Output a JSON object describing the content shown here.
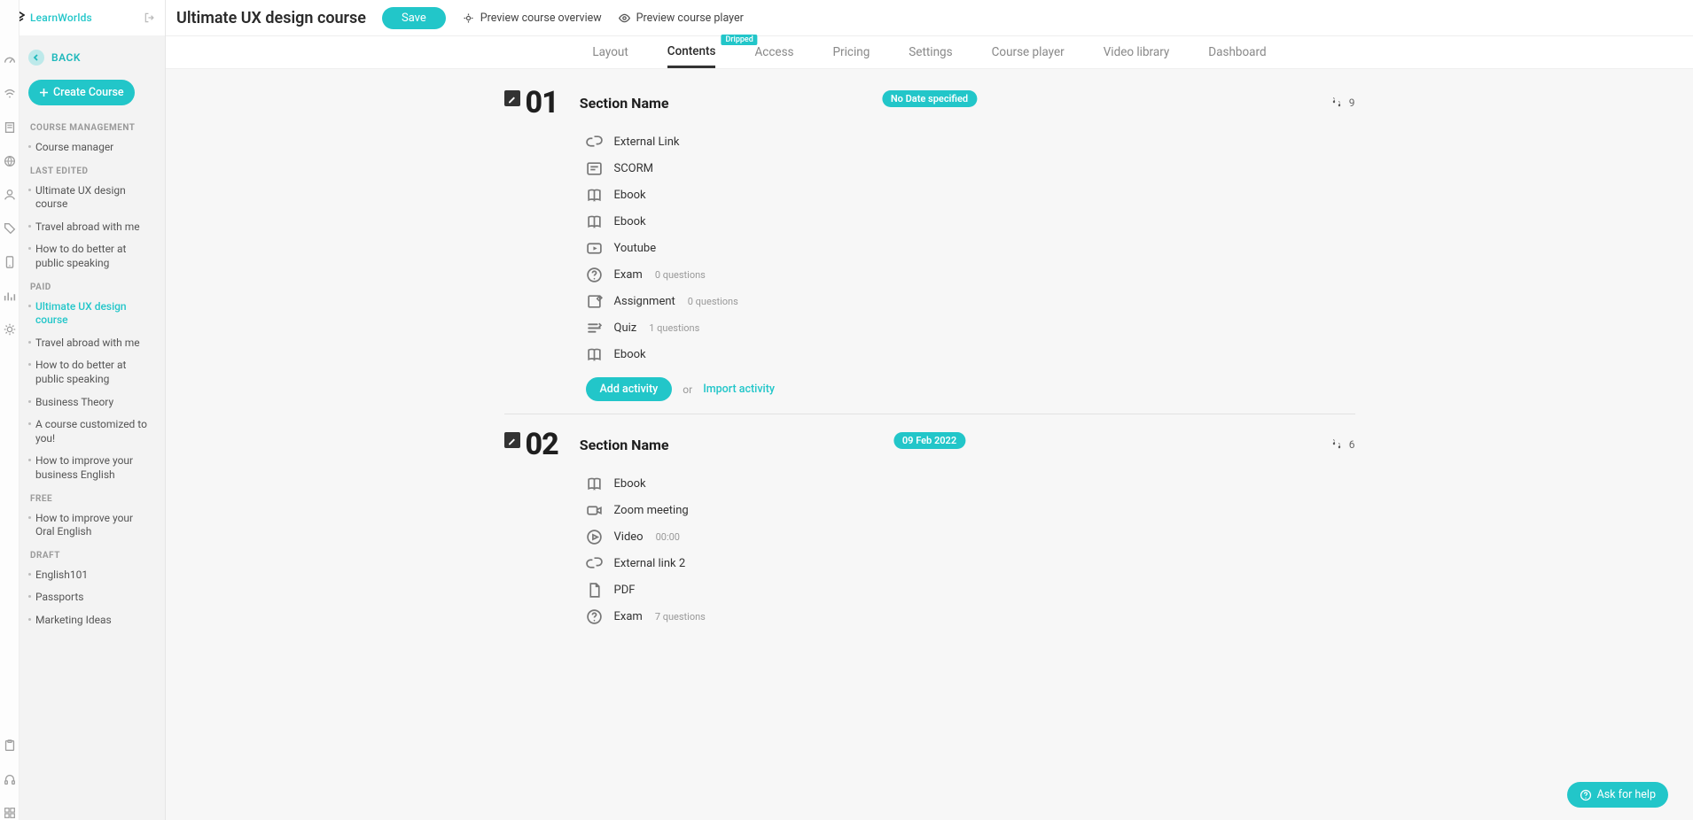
{
  "brand": "LearnWorlds",
  "back": "BACK",
  "create_course": "Create Course",
  "sidebar": {
    "headings": {
      "course_management": "COURSE MANAGEMENT",
      "last_edited": "LAST EDITED",
      "paid": "PAID",
      "free": "FREE",
      "draft": "DRAFT"
    },
    "course_management": [
      {
        "label": "Course manager"
      }
    ],
    "last_edited": [
      {
        "label": "Ultimate UX design course"
      },
      {
        "label": "Travel abroad with me"
      },
      {
        "label": "How to do better at public speaking"
      }
    ],
    "paid": [
      {
        "label": "Ultimate UX design course",
        "active": true
      },
      {
        "label": "Travel abroad with me"
      },
      {
        "label": "How to do better at public speaking"
      },
      {
        "label": "Business Theory"
      },
      {
        "label": "A course customized to you!"
      },
      {
        "label": "How to improve your business English"
      }
    ],
    "free": [
      {
        "label": "How to improve your Oral English"
      }
    ],
    "draft": [
      {
        "label": "English101"
      },
      {
        "label": "Passports"
      },
      {
        "label": "Marketing Ideas"
      }
    ]
  },
  "topbar": {
    "title": "Ultimate UX design course",
    "save": "Save",
    "preview_overview": "Preview course overview",
    "preview_player": "Preview course player"
  },
  "tabs": [
    {
      "label": "Layout"
    },
    {
      "label": "Contents",
      "active": true,
      "badge": "Dripped"
    },
    {
      "label": "Access"
    },
    {
      "label": "Pricing"
    },
    {
      "label": "Settings"
    },
    {
      "label": "Course player"
    },
    {
      "label": "Video library"
    },
    {
      "label": "Dashboard"
    }
  ],
  "sections": [
    {
      "num": "01",
      "title": "Section Name",
      "date": "No Date specified",
      "steps": "9",
      "activities": [
        {
          "icon": "link",
          "name": "External Link"
        },
        {
          "icon": "scorm",
          "name": "SCORM"
        },
        {
          "icon": "ebook",
          "name": "Ebook"
        },
        {
          "icon": "ebook",
          "name": "Ebook"
        },
        {
          "icon": "youtube",
          "name": "Youtube"
        },
        {
          "icon": "question",
          "name": "Exam",
          "meta": "0 questions"
        },
        {
          "icon": "assignment",
          "name": "Assignment",
          "meta": "0 questions"
        },
        {
          "icon": "quiz",
          "name": "Quiz",
          "meta": "1 questions"
        },
        {
          "icon": "ebook",
          "name": "Ebook"
        }
      ]
    },
    {
      "num": "02",
      "title": "Section Name",
      "date": "09 Feb 2022",
      "steps": "6",
      "activities": [
        {
          "icon": "ebook",
          "name": "Ebook"
        },
        {
          "icon": "zoom",
          "name": "Zoom meeting"
        },
        {
          "icon": "video",
          "name": "Video",
          "meta": "00:00"
        },
        {
          "icon": "link",
          "name": "External link 2"
        },
        {
          "icon": "pdf",
          "name": "PDF"
        },
        {
          "icon": "question",
          "name": "Exam",
          "meta": "7 questions"
        }
      ]
    }
  ],
  "actions": {
    "add_activity": "Add activity",
    "or": "or",
    "import_activity": "Import activity"
  },
  "help": "Ask for help"
}
